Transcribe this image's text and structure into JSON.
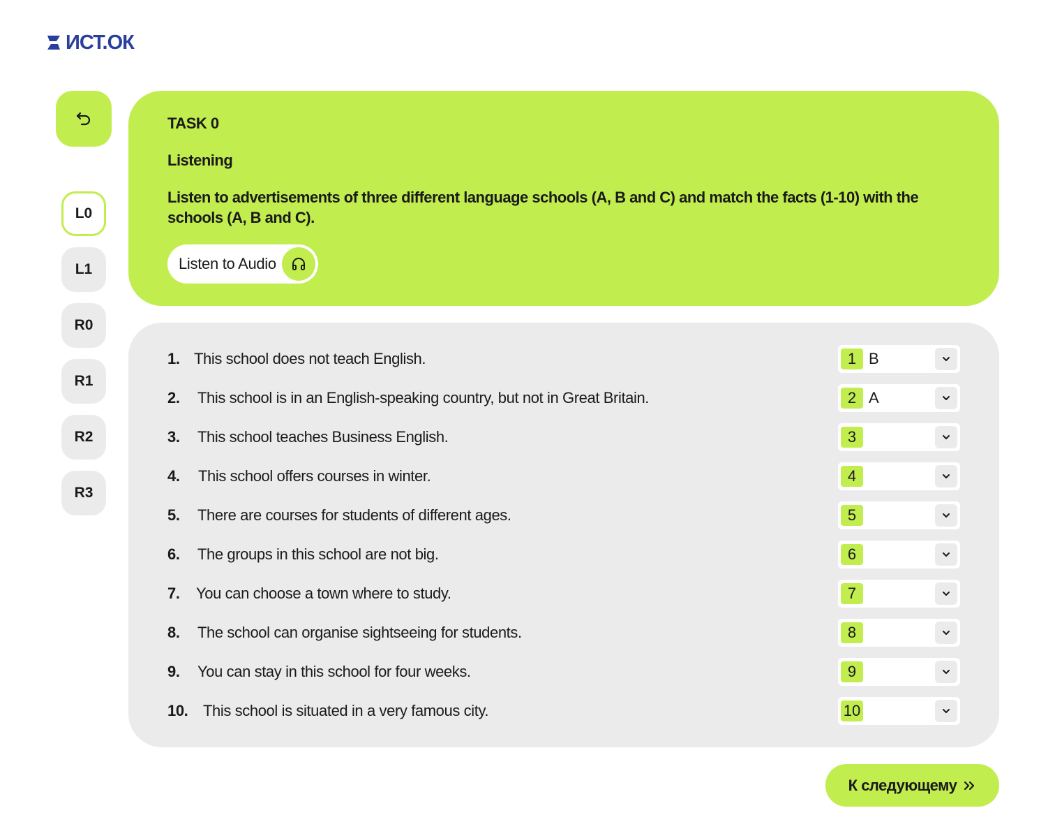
{
  "logo": {
    "text": "ИСТ.ОК",
    "color": "#2a3f9c"
  },
  "colors": {
    "accent": "#c2ed4f",
    "panel": "#ebebeb",
    "text": "#1a1a1a"
  },
  "back_button": {
    "icon": "undo-arrow-icon"
  },
  "sidebar": {
    "items": [
      {
        "label": "L0",
        "active": true
      },
      {
        "label": "L1",
        "active": false
      },
      {
        "label": "R0",
        "active": false
      },
      {
        "label": "R1",
        "active": false
      },
      {
        "label": "R2",
        "active": false
      },
      {
        "label": "R3",
        "active": false
      }
    ]
  },
  "task": {
    "title": "TASK 0",
    "subtitle": "Listening",
    "description": "Listen to advertisements of three different language schools (A, B and C) and match the facts (1-10) with the schools (A, B and C).",
    "audio_button": {
      "label": "Listen to Audio",
      "icon": "headphones-icon"
    }
  },
  "questions": [
    {
      "num": "1.",
      "text": "This school does not teach English.",
      "select_num": "1",
      "value": "B"
    },
    {
      "num": "2.",
      "text": "This school is in an English-speaking country, but not in Great Britain.",
      "select_num": "2",
      "value": "A"
    },
    {
      "num": "3.",
      "text": "This school teaches Business English.",
      "select_num": "3",
      "value": ""
    },
    {
      "num": "4.",
      "text": "This school offers courses in winter.",
      "select_num": "4",
      "value": ""
    },
    {
      "num": "5.",
      "text": "There are courses for students of different ages.",
      "select_num": "5",
      "value": ""
    },
    {
      "num": "6.",
      "text": "The groups in this school are not big.",
      "select_num": "6",
      "value": ""
    },
    {
      "num": "7.",
      "text": "You can choose a town where to study.",
      "select_num": "7",
      "value": ""
    },
    {
      "num": "8.",
      "text": "The school can organise sightseeing for students.",
      "select_num": "8",
      "value": ""
    },
    {
      "num": "9.",
      "text": "You can stay in this school for four weeks.",
      "select_num": "9",
      "value": ""
    },
    {
      "num": "10.",
      "text": "This school is situated in a very famous city.",
      "select_num": "10",
      "value": ""
    }
  ],
  "next_button": {
    "label": "К следующему",
    "icon": "double-chevron-right-icon"
  }
}
